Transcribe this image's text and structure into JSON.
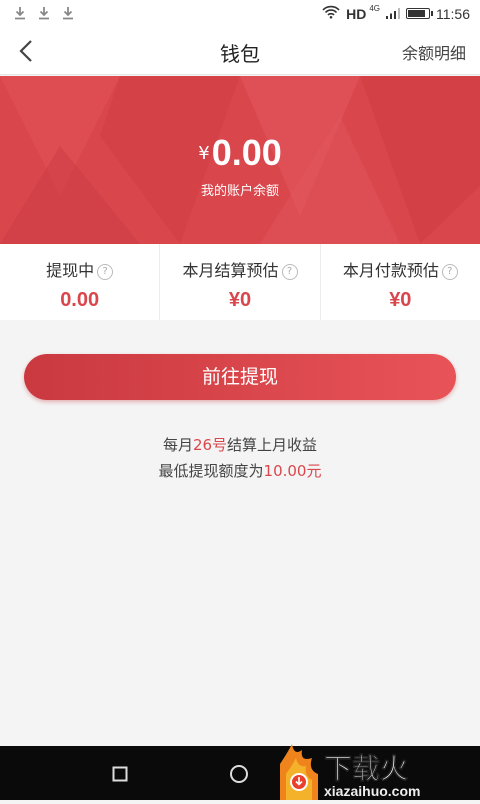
{
  "status_bar": {
    "network": "HD",
    "net_type": "4G",
    "time": "11:56",
    "battery_level": 0.9
  },
  "nav": {
    "title": "钱包",
    "right_link": "余额明细"
  },
  "balance": {
    "currency": "¥",
    "amount": "0.00",
    "label": "我的账户余额"
  },
  "stats": [
    {
      "title": "提现中",
      "value": "0.00"
    },
    {
      "title": "本月结算预估",
      "value": "¥0"
    },
    {
      "title": "本月付款预估",
      "value": "¥0"
    }
  ],
  "help_mark": "?",
  "withdraw_button": "前往提现",
  "info": {
    "line1_a": "每月",
    "line1_hl": "26号",
    "line1_b": "结算上月收益",
    "line2_a": "最低提现额度为",
    "line2_hl": "10.00元"
  },
  "watermark": {
    "brand": "下载火",
    "url": "xiazaihuo.com"
  },
  "colors": {
    "accent": "#d9474d",
    "background": "#f4f4f4"
  }
}
